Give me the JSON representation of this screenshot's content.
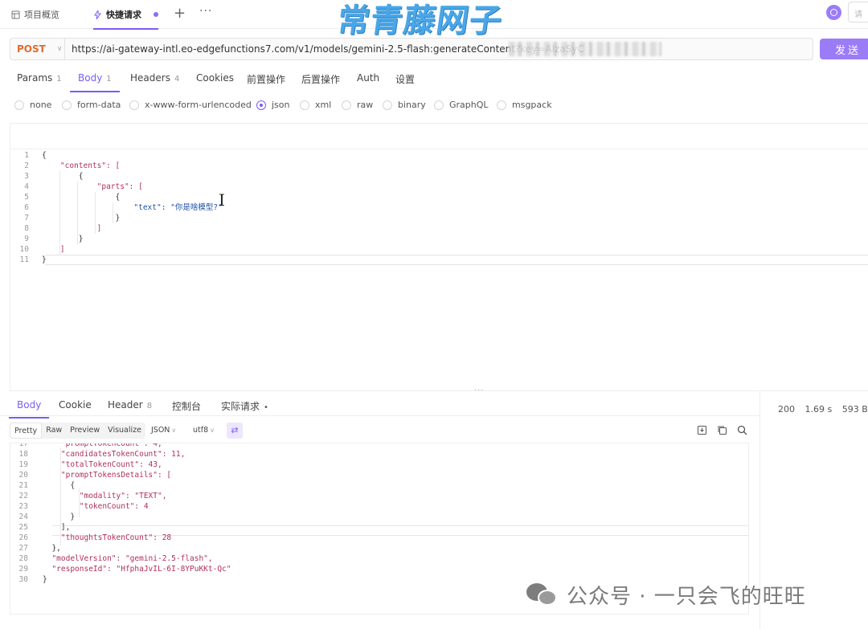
{
  "top_tabs": [
    {
      "label": "项目概览"
    },
    {
      "label": "快捷请求"
    }
  ],
  "top_search_placeholder": "请",
  "watermark_top": "常青藤网子",
  "request": {
    "method": "POST",
    "url": "https://ai-gateway-intl.eo-edgefunctions7.com/v1/models/gemini-2.5-flash:generateContent?key=AlzaSyC",
    "send_label": "发送"
  },
  "request_tabs": [
    {
      "label": "Params",
      "count": "1"
    },
    {
      "label": "Body",
      "count": "1"
    },
    {
      "label": "Headers",
      "count": "4"
    },
    {
      "label": "Cookies",
      "count": ""
    },
    {
      "label": "前置操作",
      "count": ""
    },
    {
      "label": "后置操作",
      "count": ""
    },
    {
      "label": "Auth",
      "count": ""
    },
    {
      "label": "设置",
      "count": ""
    }
  ],
  "body_types": [
    "none",
    "form-data",
    "x-www-form-urlencoded",
    "json",
    "xml",
    "raw",
    "binary",
    "GraphQL",
    "msgpack"
  ],
  "body_type_selected": "json",
  "request_body_lines": [
    {
      "n": "1",
      "t": "{"
    },
    {
      "n": "2",
      "t": "    \"contents\": ["
    },
    {
      "n": "3",
      "t": "        {"
    },
    {
      "n": "4",
      "t": "            \"parts\": ["
    },
    {
      "n": "5",
      "t": "                {"
    },
    {
      "n": "6",
      "t": "                    \"text\": \"你是啥模型?\""
    },
    {
      "n": "7",
      "t": "                }"
    },
    {
      "n": "8",
      "t": "            ]"
    },
    {
      "n": "9",
      "t": "        }"
    },
    {
      "n": "10",
      "t": "    ]"
    },
    {
      "n": "11",
      "t": "}"
    }
  ],
  "response_tabs": [
    {
      "label": "Body",
      "count": ""
    },
    {
      "label": "Cookie",
      "count": ""
    },
    {
      "label": "Header",
      "count": "8"
    },
    {
      "label": "控制台",
      "count": ""
    },
    {
      "label": "实际请求",
      "count": "•"
    }
  ],
  "response_status": {
    "code": "200",
    "time": "1.69 s",
    "size": "593 B"
  },
  "response_view_modes": [
    "Pretty",
    "Raw",
    "Preview",
    "Visualize"
  ],
  "response_format": "JSON",
  "response_encoding": "utf8",
  "response_lines": [
    {
      "n": "17",
      "t": "    \"promptTokenCount\": 4,"
    },
    {
      "n": "18",
      "t": "    \"candidatesTokenCount\": 11,"
    },
    {
      "n": "19",
      "t": "    \"totalTokenCount\": 43,"
    },
    {
      "n": "20",
      "t": "    \"promptTokensDetails\": ["
    },
    {
      "n": "21",
      "t": "      {"
    },
    {
      "n": "22",
      "t": "        \"modality\": \"TEXT\","
    },
    {
      "n": "23",
      "t": "        \"tokenCount\": 4"
    },
    {
      "n": "24",
      "t": "      }"
    },
    {
      "n": "25",
      "t": "    ],"
    },
    {
      "n": "26",
      "t": "    \"thoughtsTokenCount\": 28"
    },
    {
      "n": "27",
      "t": "  },"
    },
    {
      "n": "28",
      "t": "  \"modelVersion\": \"gemini-2.5-flash\","
    },
    {
      "n": "29",
      "t": "  \"responseId\": \"HfphaJvIL-6I-8YPuKKt-Qc\""
    },
    {
      "n": "30",
      "t": "}"
    }
  ],
  "watermark_bottom": "公众号 · 一只会飞的旺旺",
  "colors": {
    "accent": "#7b5cf5",
    "method": "#e06b2d",
    "send": "#9b7cf7"
  }
}
